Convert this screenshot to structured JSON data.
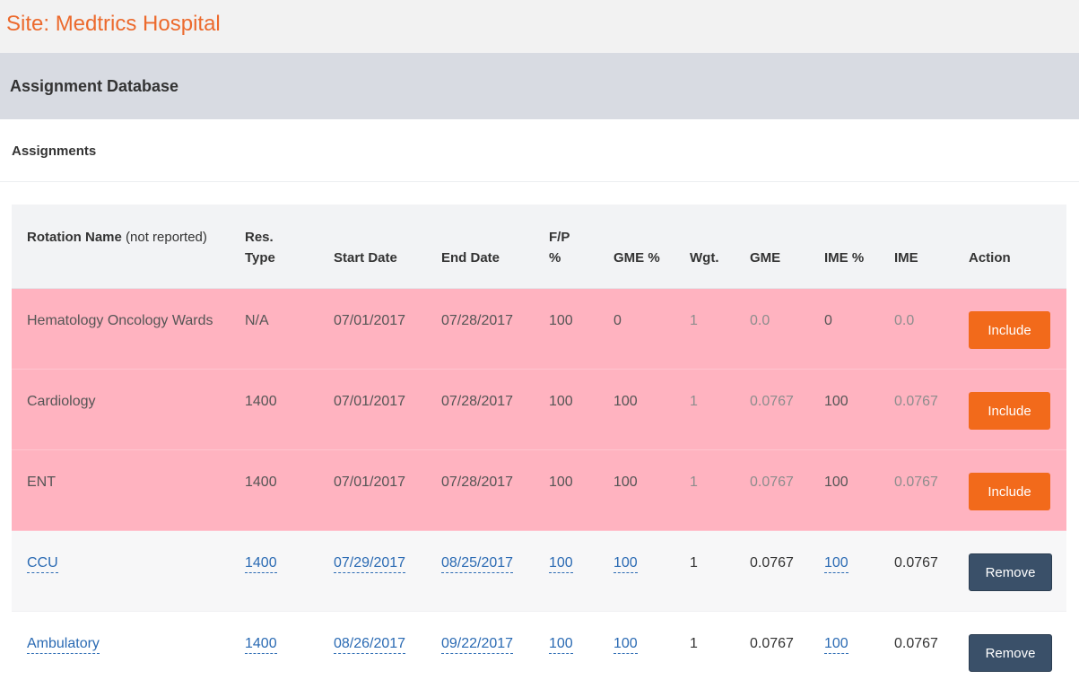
{
  "site": {
    "title": "Site: Medtrics Hospital"
  },
  "section": {
    "title": "Assignment Database"
  },
  "panel": {
    "title": "Assignments"
  },
  "columns": {
    "rotation_name": "Rotation Name",
    "rotation_note": "(not reported)",
    "res_type_1": "Res.",
    "res_type_2": "Type",
    "start_date": "Start Date",
    "end_date": "End Date",
    "fp_1": "F/P",
    "fp_2": "%",
    "gme_pct": "GME %",
    "wgt": "Wgt.",
    "gme": "GME",
    "ime_pct": "IME %",
    "ime": "IME",
    "action": "Action"
  },
  "rows": [
    {
      "name": "Hematology Oncology Wards",
      "res_type": "N/A",
      "start": "07/01/2017",
      "end": "07/28/2017",
      "fp": "100",
      "gme_pct": "0",
      "wgt": "1",
      "gme": "0.0",
      "ime_pct": "0",
      "ime": "0.0",
      "action": "Include",
      "status": "excluded"
    },
    {
      "name": "Cardiology",
      "res_type": "1400",
      "start": "07/01/2017",
      "end": "07/28/2017",
      "fp": "100",
      "gme_pct": "100",
      "wgt": "1",
      "gme": "0.0767",
      "ime_pct": "100",
      "ime": "0.0767",
      "action": "Include",
      "status": "excluded"
    },
    {
      "name": "ENT",
      "res_type": "1400",
      "start": "07/01/2017",
      "end": "07/28/2017",
      "fp": "100",
      "gme_pct": "100",
      "wgt": "1",
      "gme": "0.0767",
      "ime_pct": "100",
      "ime": "0.0767",
      "action": "Include",
      "status": "excluded"
    },
    {
      "name": "CCU",
      "res_type": "1400",
      "start": "07/29/2017",
      "end": "08/25/2017",
      "fp": "100",
      "gme_pct": "100",
      "wgt": "1",
      "gme": "0.0767",
      "ime_pct": "100",
      "ime": "0.0767",
      "action": "Remove",
      "status": "included"
    },
    {
      "name": "Ambulatory",
      "res_type": "1400",
      "start": "08/26/2017",
      "end": "09/22/2017",
      "fp": "100",
      "gme_pct": "100",
      "wgt": "1",
      "gme": "0.0767",
      "ime_pct": "100",
      "ime": "0.0767",
      "action": "Remove",
      "status": "included"
    }
  ],
  "colors": {
    "site_title": "#ec6a2d",
    "excluded_row": "#ffb3c0",
    "include_button": "#f26a1b",
    "remove_button": "#3a5069",
    "link": "#2a6ab3"
  }
}
